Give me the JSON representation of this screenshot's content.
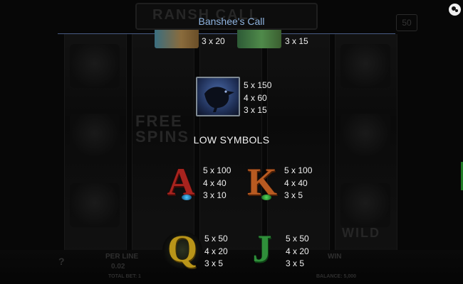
{
  "header": {
    "title": "Banshee's Call"
  },
  "background": {
    "game_title_partial": "RANSH CALL",
    "free_spins_text": "FREE SPINS",
    "wild_text": "WILD",
    "line_badge": "50",
    "bottom_labels": {
      "per_line": "PER LINE",
      "per_line_value": "0.02",
      "total_bet": "TOTAL BET: 1",
      "win": "WIN",
      "balance": "BALANCE: 5,000",
      "help": "?"
    }
  },
  "paytable": {
    "top_partial": [
      {
        "icon": "scroll-symbol-icon",
        "payouts": [
          "3 x 20"
        ]
      },
      {
        "icon": "green-relic-symbol-icon",
        "payouts": [
          "3 x 15"
        ]
      }
    ],
    "raven": {
      "icon": "raven-symbol-icon",
      "payouts": [
        "5 x 150",
        "4 x 60",
        "3 x 15"
      ]
    },
    "low_symbols_title": "LOW SYMBOLS",
    "low_symbols": [
      {
        "symbol": "A",
        "payouts": [
          "5 x 100",
          "4 x 40",
          "3 x 10"
        ]
      },
      {
        "symbol": "K",
        "payouts": [
          "5 x 100",
          "4 x 40",
          "3 x 5"
        ]
      },
      {
        "symbol": "Q",
        "payouts": [
          "5 x 50",
          "4 x 20",
          "3 x 5"
        ]
      },
      {
        "symbol": "J",
        "payouts": [
          "5 x 50",
          "4 x 20",
          "3 x 5"
        ]
      }
    ]
  },
  "colors": {
    "title": "#8fb4e0",
    "rule": "#4a5d86",
    "A": "#a8231e",
    "K": "#b85a21",
    "Q": "#b99519",
    "J": "#2f8f3a"
  }
}
